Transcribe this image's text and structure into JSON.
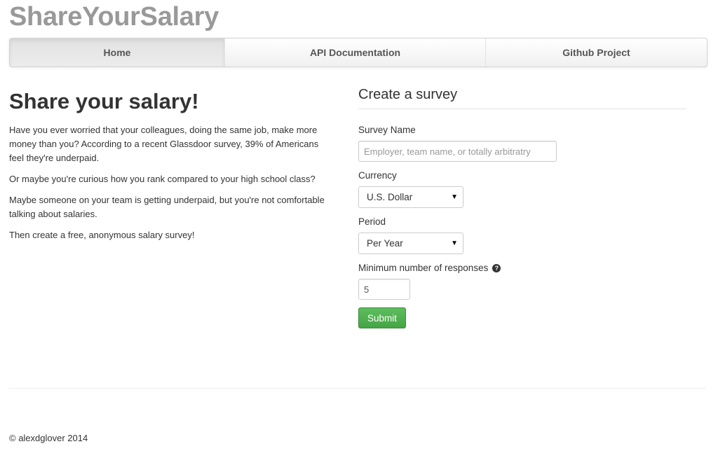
{
  "brand": "ShareYourSalary",
  "nav": {
    "items": [
      {
        "label": "Home",
        "active": true
      },
      {
        "label": "API Documentation",
        "active": false
      },
      {
        "label": "Github Project",
        "active": false
      }
    ]
  },
  "intro": {
    "title": "Share your salary!",
    "paragraphs": [
      "Have you ever worried that your colleagues, doing the same job, make more money than you? According to a recent Glassdoor survey, 39% of Americans feel they're underpaid.",
      "Or maybe you're curious how you rank compared to your high school class?",
      "Maybe someone on your team is getting underpaid, but you're not comfortable talking about salaries.",
      "Then create a free, anonymous salary survey!"
    ]
  },
  "form": {
    "title": "Create a survey",
    "survey_name": {
      "label": "Survey Name",
      "placeholder": "Employer, team name, or totally arbitratry",
      "value": ""
    },
    "currency": {
      "label": "Currency",
      "selected": "U.S. Dollar"
    },
    "period": {
      "label": "Period",
      "selected": "Per Year"
    },
    "min_responses": {
      "label": "Minimum number of responses",
      "help_icon": "question-circle-icon",
      "help_glyph": "?",
      "value": "5"
    },
    "submit_label": "Submit",
    "submit_color": "#4cae4c"
  },
  "footer": {
    "text": "© alexdglover 2014"
  }
}
